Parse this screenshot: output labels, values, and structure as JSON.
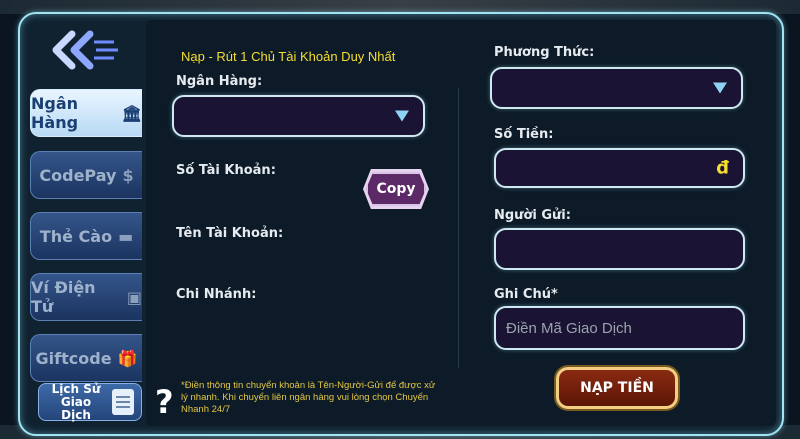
{
  "nav": {
    "tabs": [
      {
        "label": "Ngân Hàng",
        "icon": "bank-icon",
        "active": true
      },
      {
        "label": "CodePay",
        "icon": "coins-icon",
        "active": false
      },
      {
        "label": "Thẻ Cào",
        "icon": "card-icon",
        "active": false
      },
      {
        "label": "Ví Điện Tử",
        "icon": "wallet-icon",
        "active": false
      },
      {
        "label": "Giftcode",
        "icon": "gift-icon",
        "active": false
      }
    ],
    "history_label": "Lịch Sử Giao Dịch"
  },
  "form": {
    "notice": "Nạp - Rút 1 Chủ Tài Khoản Duy Nhất",
    "bank_label": "Ngân Hàng:",
    "account_number_label": "Số Tài Khoản:",
    "copy_label": "Copy",
    "account_name_label": "Tên Tài Khoản:",
    "branch_label": "Chi Nhánh:",
    "method_label": "Phương Thức:",
    "amount_label": "Số Tiền:",
    "currency_symbol": "đ",
    "sender_label": "Người Gửi:",
    "note_label": "Ghi Chú*",
    "note_placeholder": "Điền Mã Giao Dịch",
    "submit_label": "NẠP TIỀN",
    "hint": "*Điền thông tin chuyển khoản là Tên-Người-Gửi để được xử lý nhanh. Khi chuyển liên ngân hàng vui lòng chọn Chuyển Nhanh 24/7"
  },
  "colors": {
    "accent_yellow": "#f4de33",
    "field_border": "#cfe9f2",
    "active_tab": "#e9f5ff"
  }
}
